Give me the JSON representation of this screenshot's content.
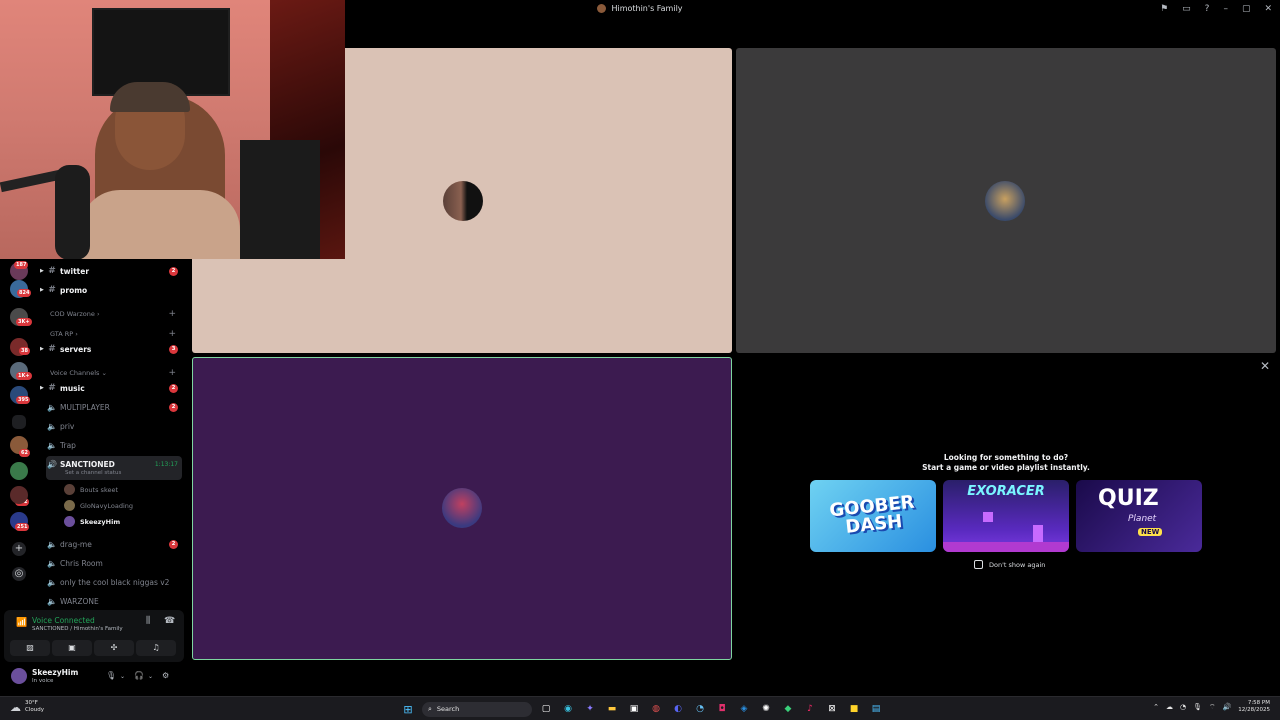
{
  "window": {
    "title": "Himothin's Family",
    "controls": [
      "⚑",
      "▭",
      "?",
      "–",
      "▢",
      "✕"
    ]
  },
  "rail": {
    "badges": [
      "187",
      "824",
      "3K+",
      "38",
      "1K+",
      "395",
      "62",
      "252",
      "251"
    ]
  },
  "sidebar": {
    "channels_top": [
      {
        "name": "twitter",
        "badge": "2"
      },
      {
        "name": "promo",
        "badge": ""
      }
    ],
    "categories": {
      "cod": "COD Warzone",
      "gta": "GTA RP",
      "voice": "Voice Channels"
    },
    "servers_channel": {
      "name": "servers",
      "badge": "3"
    },
    "voice_channels": [
      {
        "name": "music",
        "badge": "2",
        "type": "text"
      },
      {
        "name": "MULTIPLAYER",
        "badge": "2",
        "type": "voice"
      },
      {
        "name": "priv",
        "badge": "",
        "type": "voice"
      },
      {
        "name": "Trap",
        "badge": "",
        "type": "voice"
      }
    ],
    "active_channel": {
      "name": "SANCTIONED",
      "timer": "1:13:17",
      "status": "Set a channel status"
    },
    "members": [
      "Bouts skeet",
      "GloNavyLoading",
      "SkeezyHim"
    ],
    "more_channels": [
      {
        "name": "drag-me",
        "badge": "2"
      },
      {
        "name": "Chris Room",
        "badge": ""
      },
      {
        "name": "only the cool black niggas v2",
        "badge": ""
      },
      {
        "name": "WARZONE",
        "badge": ""
      }
    ]
  },
  "voice_panel": {
    "title": "Voice Connected",
    "subtitle": "SANCTIONED / Himothin's Family"
  },
  "user": {
    "name": "SkeezyHim",
    "status": "In voice"
  },
  "activity": {
    "title": "Looking for something to do?",
    "subtitle": "Start a game or video playlist instantly.",
    "cards": [
      {
        "text": "GOOBER DASH"
      },
      {
        "text": "EXORACER"
      },
      {
        "text": "QUIZ",
        "sub": "Planet",
        "tag": "NEW"
      }
    ],
    "dont_show": "Don't show again"
  },
  "taskbar": {
    "weather_temp": "30°F",
    "weather_desc": "Cloudy",
    "search_label": "Search",
    "time": "7:58 PM",
    "date": "12/28/2025"
  },
  "colors": {
    "tile1": "#dac2b5",
    "tile2": "#3b3a3b",
    "tile3": "#3c1b50",
    "speaking_border": "#7ed6a0",
    "badge": "#da373c",
    "connected": "#23a55a"
  }
}
